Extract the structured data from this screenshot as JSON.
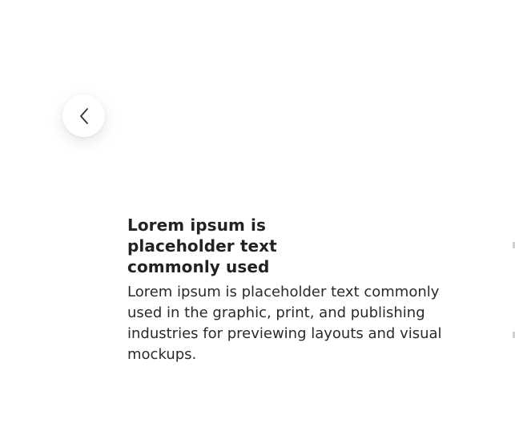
{
  "slide": {
    "title": "Lorem ipsum is placeholder text commonly used",
    "description": "Lorem ipsum is placeholder text commonly used in the graphic, print, and publishing industries for previewing layouts and visual mockups."
  },
  "controls": {
    "prev_icon": "chevron-left-icon"
  }
}
